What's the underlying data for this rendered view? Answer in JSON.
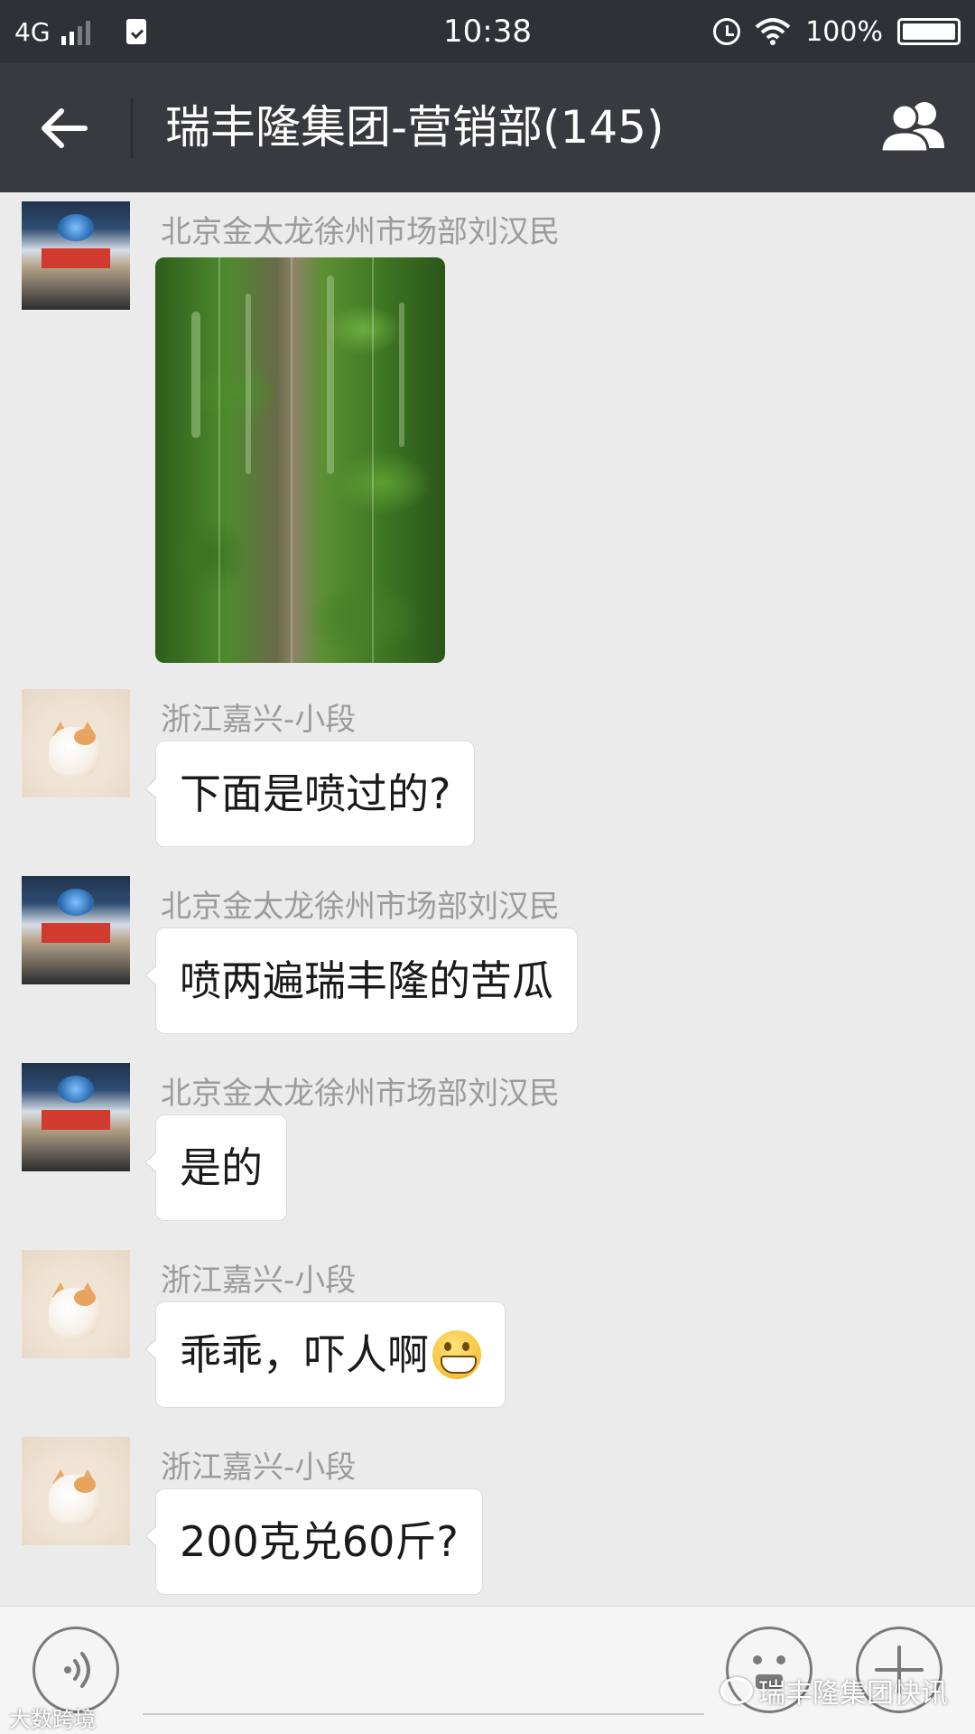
{
  "status_bar": {
    "network": "4G",
    "time": "10:38",
    "battery": "100%"
  },
  "header": {
    "title": "瑞丰隆集团-营销部(145)",
    "back_icon": "arrow-left-icon",
    "members_icon": "group-members-icon"
  },
  "messages": [
    {
      "sender": "北京金太龙徐州市场部刘汉民",
      "type": "image",
      "avatar": "fertilizer-bag",
      "image_desc_icon": "bitter-melon-greenhouse-photo"
    },
    {
      "sender": "浙江嘉兴-小段",
      "type": "text",
      "avatar": "kitten",
      "text": "下面是喷过的?"
    },
    {
      "sender": "北京金太龙徐州市场部刘汉民",
      "type": "text",
      "avatar": "fertilizer-bag",
      "text": "喷两遍瑞丰隆的苦瓜"
    },
    {
      "sender": "北京金太龙徐州市场部刘汉民",
      "type": "text",
      "avatar": "fertilizer-bag",
      "text": "是的"
    },
    {
      "sender": "浙江嘉兴-小段",
      "type": "text",
      "avatar": "kitten",
      "text": "乖乖，吓人啊",
      "emoji": "grinning-face"
    },
    {
      "sender": "浙江嘉兴-小段",
      "type": "text",
      "avatar": "kitten",
      "text": "200克兑60斤?"
    }
  ],
  "input_bar": {
    "voice_icon": "voice-icon",
    "emoji_icon": "emoji-icon",
    "more_icon": "plus-icon"
  },
  "watermarks": {
    "right": "瑞丰隆集团快讯",
    "left": "大数跨境"
  },
  "colors": {
    "header_bg": "#393a3f",
    "status_bg": "#2e3135",
    "chat_bg": "#ebebeb",
    "bubble_bg": "#ffffff",
    "sender_text": "#9b9b9b"
  }
}
